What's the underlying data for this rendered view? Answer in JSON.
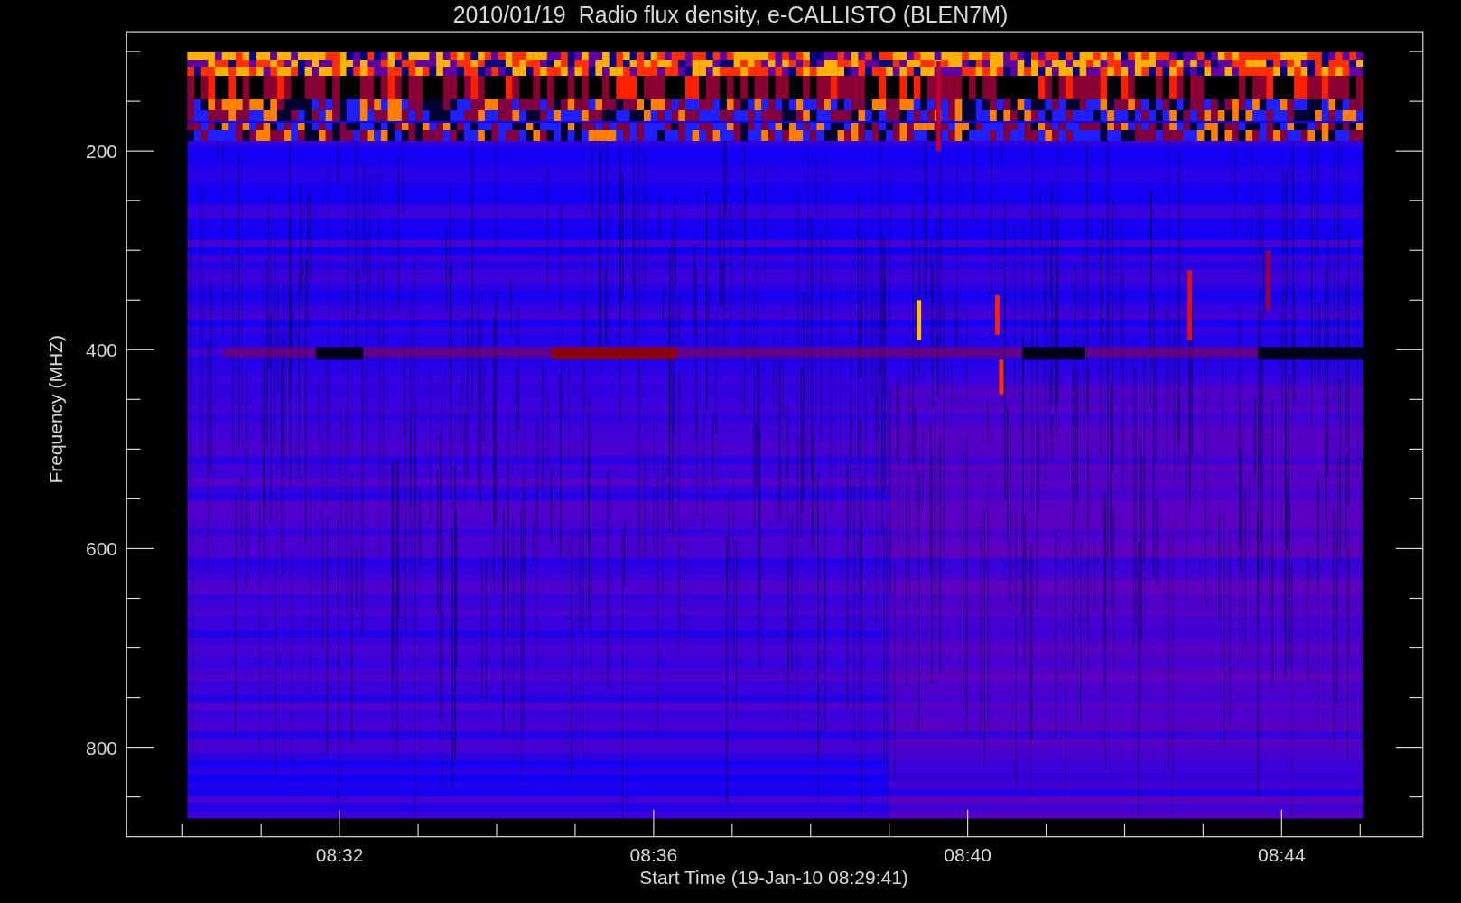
{
  "title": "2010/01/19  Radio flux density, e-CALLISTO (BLEN7M)",
  "plot": {
    "ylabel": "Frequency (MHZ)",
    "xlabel": "Start Time (19-Jan-10 08:29:41)",
    "yticks": [
      "200",
      "400",
      "600",
      "800"
    ],
    "xticks": [
      "08:32",
      "08:36",
      "08:40",
      "08:44"
    ]
  }
}
